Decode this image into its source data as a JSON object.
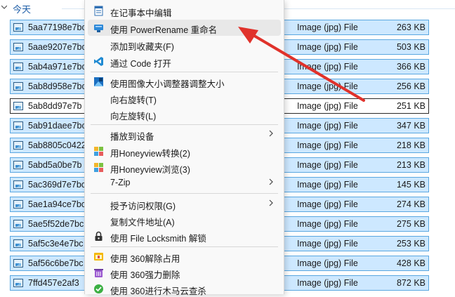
{
  "group": {
    "title": "今天"
  },
  "files": [
    {
      "name": "5aa77198e7bc",
      "type": "Image (jpg) File",
      "size": "263 KB"
    },
    {
      "name": "5aae9207e7bc",
      "type": "Image (jpg) File",
      "size": "503 KB"
    },
    {
      "name": "5ab4a971e7bc",
      "type": "Image (jpg) File",
      "size": "366 KB"
    },
    {
      "name": "5ab8d958e7bc",
      "type": "Image (jpg) File",
      "size": "256 KB"
    },
    {
      "name": "5ab8dd97e7b",
      "type": "Image (jpg) File",
      "size": "251 KB"
    },
    {
      "name": "5ab91daee7bc",
      "type": "Image (jpg) File",
      "size": "347 KB"
    },
    {
      "name": "5ab8805c0422",
      "type": "Image (jpg) File",
      "size": "218 KB"
    },
    {
      "name": "5abd5a0be7b",
      "type": "Image (jpg) File",
      "size": "213 KB"
    },
    {
      "name": "5ac369d7e7bc",
      "type": "Image (jpg) File",
      "size": "145 KB"
    },
    {
      "name": "5ae1a94ce7bc",
      "type": "Image (jpg) File",
      "size": "274 KB"
    },
    {
      "name": "5ae5f52de7bc",
      "type": "Image (jpg) File",
      "size": "275 KB"
    },
    {
      "name": "5af5c3e4e7bc",
      "type": "Image (jpg) File",
      "size": "253 KB"
    },
    {
      "name": "5af56c6be7bc",
      "type": "Image (jpg) File",
      "size": "428 KB"
    },
    {
      "name": "7ffd457e2af3",
      "type": "Image (jpg) File",
      "size": "872 KB"
    }
  ],
  "menu": {
    "items": [
      {
        "label": "在记事本中编辑",
        "icon": "notepad-icon"
      },
      {
        "label": "使用 PowerRename 重命名",
        "icon": "powerrename-icon"
      },
      {
        "label": "添加到收藏夹(F)",
        "icon": ""
      },
      {
        "label": "通过 Code 打开",
        "icon": "vscode-icon"
      },
      {
        "label": "使用图像大小调整器调整大小",
        "icon": "image-resizer-icon"
      },
      {
        "label": "向右旋转(T)",
        "icon": ""
      },
      {
        "label": "向左旋转(L)",
        "icon": ""
      },
      {
        "label": "播放到设备",
        "icon": ""
      },
      {
        "label": "用Honeyview转换(2)",
        "icon": "honeyview-icon"
      },
      {
        "label": "用Honeyview浏览(3)",
        "icon": "honeyview-icon"
      },
      {
        "label": "7-Zip",
        "icon": ""
      },
      {
        "label": "授予访问权限(G)",
        "icon": ""
      },
      {
        "label": "复制文件地址(A)",
        "icon": ""
      },
      {
        "label": "使用 File Locksmith 解锁",
        "icon": "lock-icon"
      },
      {
        "label": "使用 360解除占用",
        "icon": "360-unlock-icon"
      },
      {
        "label": "使用 360强力删除",
        "icon": "360-delete-icon"
      },
      {
        "label": "使用 360进行木马云查杀",
        "icon": "360-scan-icon"
      }
    ]
  },
  "colors": {
    "selection": "#cde8ff",
    "selection_border": "#5aa7e0",
    "arrow": "#e0322b"
  }
}
